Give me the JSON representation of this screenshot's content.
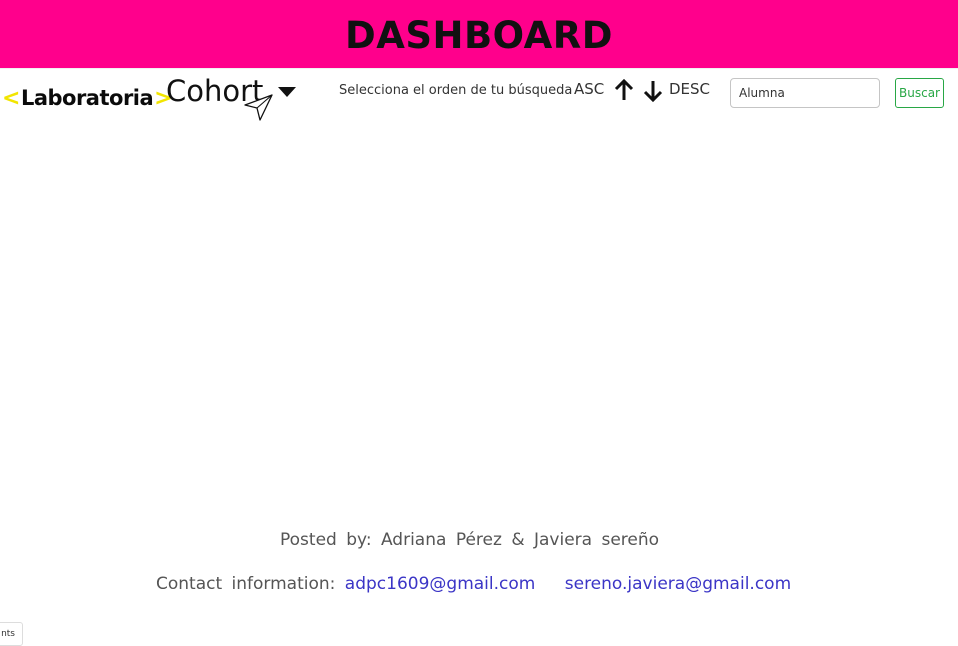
{
  "header": {
    "title": "DASHBOARD"
  },
  "navbar": {
    "logo": {
      "left_bracket": "<",
      "text": "Laboratoria",
      "right_bracket": ">"
    },
    "cohort_label": "Cohort",
    "order_prompt": "Selecciona el orden de tu búsqueda",
    "sort_asc_label": "ASC",
    "sort_desc_label": "DESC",
    "search": {
      "placeholder": "Alumna",
      "value": ""
    },
    "search_button_label": "Buscar"
  },
  "footer": {
    "posted_by": "Posted by: Adriana Pérez & Javiera sereño",
    "contact_label": "Contact information:",
    "emails": [
      "adpc1609@gmail.com",
      "sereno.javiera@gmail.com"
    ]
  },
  "corner_tab_label": "nts",
  "colors": {
    "banner": "#ff008c",
    "logo_bracket": "#f2e500",
    "search_button": "#28a745",
    "link": "#3b35c6"
  },
  "icons": {
    "dropdown": "caret-down-icon",
    "asc": "arrow-up-icon",
    "desc": "arrow-down-icon",
    "cursor": "mouse-pointer-icon"
  }
}
